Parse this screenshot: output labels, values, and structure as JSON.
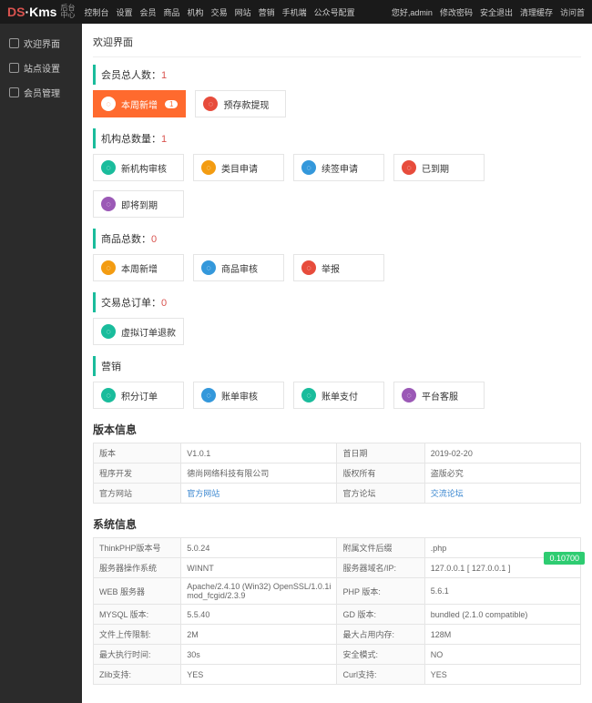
{
  "logo": {
    "ds": "DS",
    "dot": "·",
    "kms": "Kms",
    "sub1": "后台",
    "sub2": "中心"
  },
  "topnav": [
    "控制台",
    "设置",
    "会员",
    "商品",
    "机构",
    "交易",
    "网站",
    "营销",
    "手机端",
    "公众号配置"
  ],
  "topright": {
    "hello": "您好,admin",
    "pwd": "修改密码",
    "logout": "安全退出",
    "clear": "清理缓存",
    "visit": "访问首"
  },
  "sidebar": [
    {
      "label": "欢迎界面"
    },
    {
      "label": "站点设置"
    },
    {
      "label": "会员管理"
    }
  ],
  "pageTitle": "欢迎界面",
  "sections": {
    "members": {
      "title": "会员总人数：",
      "count": "1",
      "tiles": [
        {
          "label": "本周新增",
          "badge": "1",
          "primary": true,
          "color": "c-orange"
        },
        {
          "label": "预存款提现",
          "color": "c-red"
        }
      ]
    },
    "orgs": {
      "title": "机构总数量：",
      "count": "1",
      "tiles": [
        {
          "label": "新机构审核",
          "color": "c-green"
        },
        {
          "label": "类目申请",
          "color": "c-orange"
        },
        {
          "label": "续签申请",
          "color": "c-blue"
        },
        {
          "label": "已到期",
          "color": "c-red"
        },
        {
          "label": "即将到期",
          "color": "c-purple"
        }
      ]
    },
    "goods": {
      "title": "商品总数：",
      "count": "0",
      "tiles": [
        {
          "label": "本周新增",
          "color": "c-orange"
        },
        {
          "label": "商品审核",
          "color": "c-blue"
        },
        {
          "label": "举报",
          "color": "c-red"
        }
      ]
    },
    "orders": {
      "title": "交易总订单：",
      "count": "0",
      "tiles": [
        {
          "label": "虚拟订单退款",
          "color": "c-green"
        }
      ]
    },
    "marketing": {
      "title": "营销",
      "count": "",
      "tiles": [
        {
          "label": "积分订单",
          "color": "c-green"
        },
        {
          "label": "账单审核",
          "color": "c-blue"
        },
        {
          "label": "账单支付",
          "color": "c-green"
        },
        {
          "label": "平台客服",
          "color": "c-purple"
        }
      ]
    }
  },
  "version": {
    "title": "版本信息",
    "rows": [
      [
        "版本",
        "V1.0.1",
        "首日期",
        "2019-02-20"
      ],
      [
        "程序开发",
        "德尚网络科技有限公司",
        "版权所有",
        "盗版必究"
      ],
      [
        "官方网站",
        "官方网站",
        "官方论坛",
        "交流论坛"
      ]
    ],
    "linkCells": [
      [
        2,
        1
      ],
      [
        2,
        3
      ]
    ]
  },
  "system": {
    "title": "系统信息",
    "rows": [
      [
        "ThinkPHP版本号",
        "5.0.24",
        "附属文件后缀",
        ".php"
      ],
      [
        "服务器操作系统",
        "WINNT",
        "服务器域名/IP:",
        "127.0.0.1 [ 127.0.0.1 ]"
      ],
      [
        "WEB 服务器",
        "Apache/2.4.10 (Win32) OpenSSL/1.0.1i mod_fcgid/2.3.9",
        "PHP 版本:",
        "5.6.1"
      ],
      [
        "MYSQL 版本:",
        "5.5.40",
        "GD 版本:",
        "bundled (2.1.0 compatible)"
      ],
      [
        "文件上传限制:",
        "2M",
        "最大占用内存:",
        "128M"
      ],
      [
        "最大执行时间:",
        "30s",
        "安全模式:",
        "NO"
      ],
      [
        "Zlib支持:",
        "YES",
        "Curl支持:",
        "YES"
      ]
    ]
  },
  "perf": "0.10700"
}
